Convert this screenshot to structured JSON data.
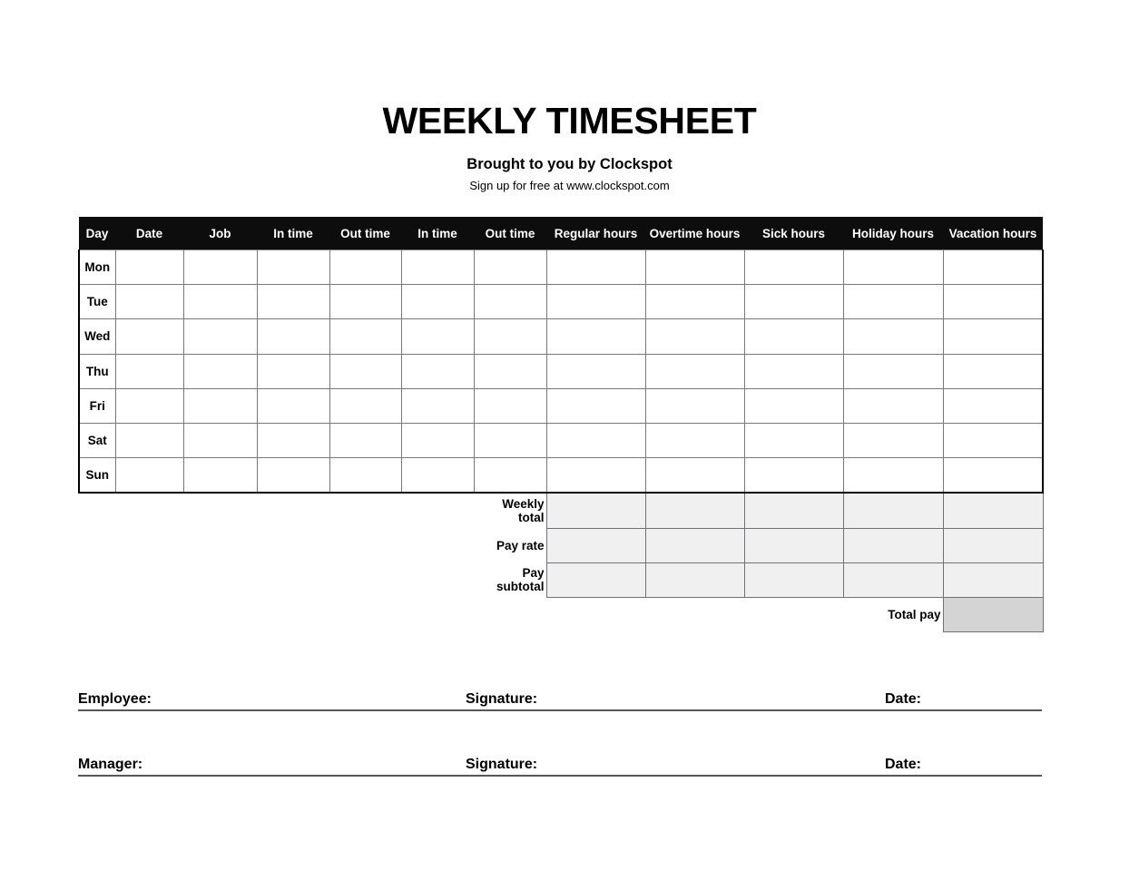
{
  "document": {
    "title": "WEEKLY TIMESHEET",
    "subtitle": "Brought to you by Clockspot",
    "url_line": "Sign up for free at www.clockspot.com"
  },
  "table": {
    "columns": [
      "Day",
      "Date",
      "Job",
      "In time",
      "Out time",
      "In time",
      "Out time",
      "Regular hours",
      "Overtime hours",
      "Sick hours",
      "Holiday hours",
      "Vacation hours"
    ],
    "rows": [
      {
        "day": "Mon"
      },
      {
        "day": "Tue"
      },
      {
        "day": "Wed"
      },
      {
        "day": "Thu"
      },
      {
        "day": "Fri"
      },
      {
        "day": "Sat"
      },
      {
        "day": "Sun"
      }
    ],
    "summary": {
      "weekly_total_label": "Weekly total",
      "pay_rate_label": "Pay rate",
      "pay_subtotal_label": "Pay subtotal",
      "total_pay_label": "Total pay"
    }
  },
  "signatures": {
    "employee_label": "Employee:",
    "manager_label": "Manager:",
    "signature_label": "Signature:",
    "date_label": "Date:"
  },
  "colors": {
    "header_bg": "#0d0d0d",
    "header_text": "#ffffff",
    "grid_line": "#77797c",
    "frame": "#000000",
    "summary_cell": "#f0f0f0",
    "total_cell": "#d4d4d4",
    "page_bg": "#ffffff"
  }
}
